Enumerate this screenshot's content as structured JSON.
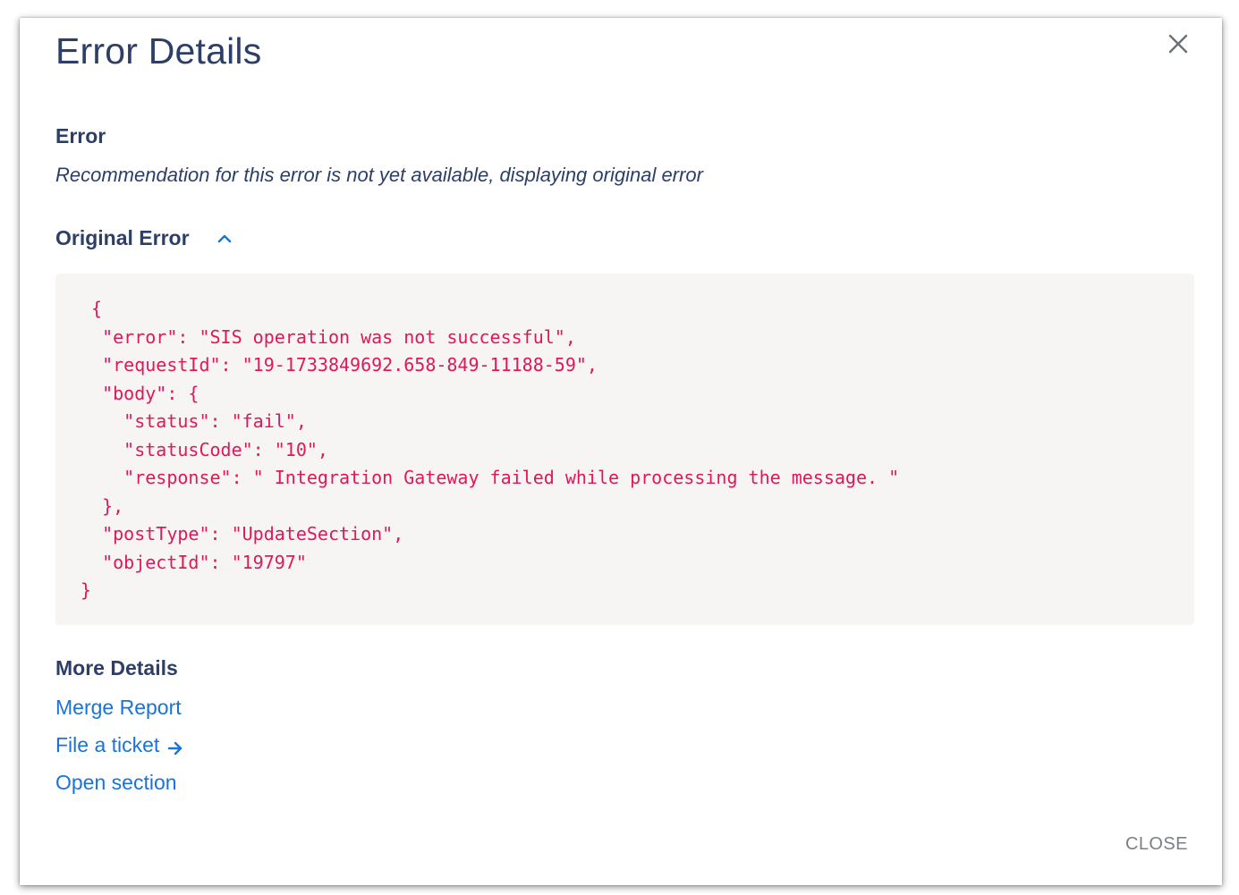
{
  "dialog": {
    "title": "Error Details",
    "close_icon": "close-icon",
    "close_button_label": "CLOSE"
  },
  "error_section": {
    "label": "Error",
    "recommendation": "Recommendation for this error is not yet available, displaying original error"
  },
  "original_error": {
    "label": "Original Error",
    "toggle_icon": "chevron-up-icon",
    "lines": [
      " {",
      "  \"error\": \"SIS operation was not successful\",",
      "  \"requestId\": \"19-1733849692.658-849-11188-59\",",
      "  \"body\": {",
      "    \"status\": \"fail\",",
      "    \"statusCode\": \"10\",",
      "    \"response\": \" Integration Gateway failed while processing the message. \"",
      "  },",
      "  \"postType\": \"UpdateSection\",",
      "  \"objectId\": \"19797\"",
      "}"
    ]
  },
  "more_details": {
    "label": "More Details",
    "links": {
      "merge_report": "Merge Report",
      "file_ticket": "File a ticket",
      "open_section": "Open section"
    },
    "file_ticket_icon": "arrow-right-icon"
  },
  "colors": {
    "heading": "#2d3f66",
    "code_text": "#e0175a",
    "code_background": "#f6f5f3",
    "link": "#1a73d9",
    "close_button": "#7b7f86"
  }
}
